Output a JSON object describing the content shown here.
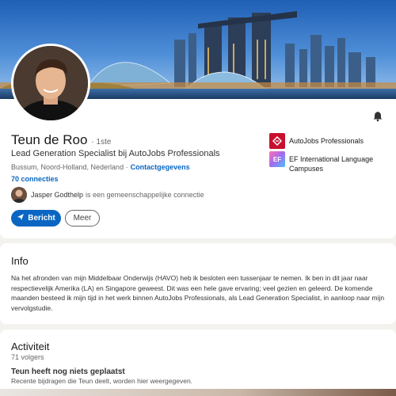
{
  "profile": {
    "name": "Teun de Roo",
    "degree": "· 1ste",
    "headline": "Lead Generation Specialist bij AutoJobs Professionals",
    "location": "Bussum, Noord-Holland, Nederland ·",
    "contact_label": "Contactgegevens",
    "connections": "70 connecties",
    "mutual": {
      "name": "Jasper Godthelp",
      "text": "is een gemeenschappelijke connectie"
    },
    "actions": {
      "message_label": "Bericht",
      "more_label": "Meer"
    },
    "companies": [
      {
        "label": "AutoJobs Professionals",
        "icon": "autojobs-logo",
        "color": "#c8102e"
      },
      {
        "label": "EF International Language Campuses",
        "icon": "ef-logo",
        "logo_text": "EF"
      }
    ]
  },
  "info": {
    "title": "Info",
    "text": "Na het afronden van mijn Middelbaar Onderwijs (HAVO) heb ik besloten een tussenjaar te nemen. Ik ben in dit jaar naar respectievelijk Amerika (LA) en Singapore geweest. Dit was een hele gave ervaring; veel gezien en geleerd. De komende maanden besteed ik mijn tijd in het werk binnen AutoJobs Professionals, als Lead Generation Specialist, in aanloop naar mijn vervolgstudie."
  },
  "activity": {
    "title": "Activiteit",
    "followers": "71 volgers",
    "empty_title": "Teun heeft nog niets geplaatst",
    "empty_subtitle": "Recente bijdragen die Teun deelt, worden hier weergegeven."
  },
  "colors": {
    "accent": "#0a66c2",
    "background": "#f3f2ef"
  },
  "icons": {
    "bell": "bell-icon",
    "send": "send-icon"
  }
}
